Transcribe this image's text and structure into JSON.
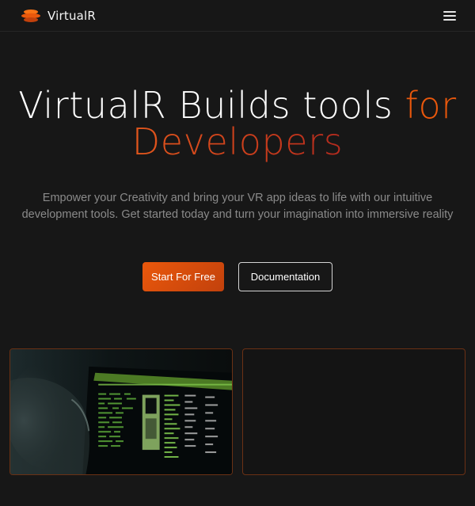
{
  "navbar": {
    "brand_name": "VirtualR",
    "menu_icon": "hamburger-menu-icon"
  },
  "hero": {
    "title_white": "VirtualR Builds tools ",
    "title_accent": "for",
    "title_gradient": "Developers",
    "subtitle": "Empower your Creativity and bring your VR app ideas to life with our intuitive development tools. Get started today and turn your imagination into immersive reality"
  },
  "actions": {
    "primary_label": "Start For Free",
    "secondary_label": "Documentation"
  },
  "colors": {
    "background": "#171717",
    "accent": "#ea580c",
    "card_border": "#6b3114"
  }
}
